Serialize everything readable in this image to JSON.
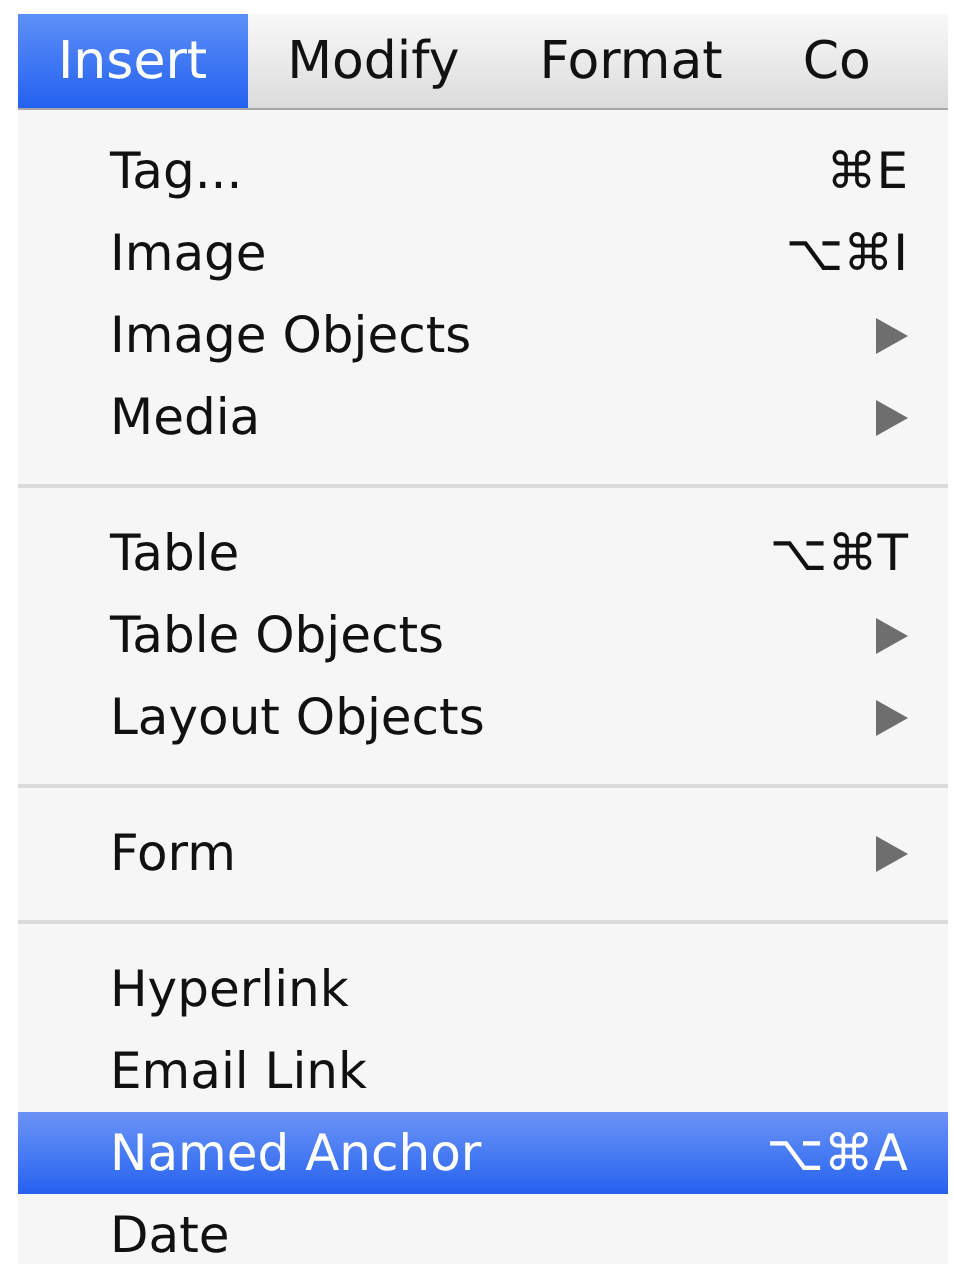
{
  "menu_bar": [
    {
      "label": "Insert",
      "selected": true
    },
    {
      "label": "Modify",
      "selected": false
    },
    {
      "label": "Format",
      "selected": false
    },
    {
      "label": "Co",
      "selected": false
    }
  ],
  "menu": {
    "items": [
      {
        "kind": "item",
        "label": "Tag...",
        "shortcut": "⌘E",
        "submenu": false,
        "selected": false
      },
      {
        "kind": "item",
        "label": "Image",
        "shortcut": "⌥⌘I",
        "submenu": false,
        "selected": false
      },
      {
        "kind": "item",
        "label": "Image Objects",
        "submenu": true,
        "selected": false
      },
      {
        "kind": "item",
        "label": "Media",
        "submenu": true,
        "selected": false
      },
      {
        "kind": "separator"
      },
      {
        "kind": "item",
        "label": "Table",
        "shortcut": "⌥⌘T",
        "submenu": false,
        "selected": false
      },
      {
        "kind": "item",
        "label": "Table Objects",
        "submenu": true,
        "selected": false
      },
      {
        "kind": "item",
        "label": "Layout Objects",
        "submenu": true,
        "selected": false
      },
      {
        "kind": "separator"
      },
      {
        "kind": "item",
        "label": "Form",
        "submenu": true,
        "selected": false
      },
      {
        "kind": "separator"
      },
      {
        "kind": "item",
        "label": "Hyperlink",
        "submenu": false,
        "selected": false
      },
      {
        "kind": "item",
        "label": "Email Link",
        "submenu": false,
        "selected": false
      },
      {
        "kind": "item",
        "label": "Named Anchor",
        "shortcut": "⌥⌘A",
        "submenu": false,
        "selected": true
      },
      {
        "kind": "item",
        "label": "Date",
        "submenu": false,
        "selected": false
      }
    ]
  }
}
